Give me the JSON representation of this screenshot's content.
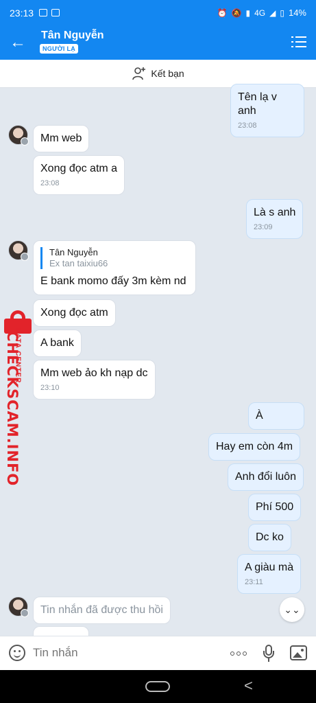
{
  "status_bar": {
    "time": "23:13",
    "battery": "14%",
    "network": "4G"
  },
  "header": {
    "contact_name": "Tân Nguyễn",
    "badge": "NGƯỜI LẠ",
    "back_icon": "arrow-left-icon",
    "menu_icon": "list-menu-icon"
  },
  "add_friend": {
    "label": "Kết bạn",
    "icon": "add-person-icon"
  },
  "messages": [
    {
      "from": "me",
      "text": "Tên lạ v anh",
      "time": "23:08"
    },
    {
      "from": "them",
      "text": "Mm web"
    },
    {
      "from": "them",
      "text": "Xong đọc atm a",
      "time": "23:08"
    },
    {
      "from": "me",
      "text": "Là s anh",
      "time": "23:09"
    },
    {
      "from": "them",
      "quote_name": "Tân Nguyễn",
      "quote_text": "Ex tan taixiu66",
      "text": "E bank momo đấy 3m kèm nd"
    },
    {
      "from": "them",
      "text": "Xong đọc atm"
    },
    {
      "from": "them",
      "text": "A bank"
    },
    {
      "from": "them",
      "text": "Mm web ảo kh nạp dc",
      "time": "23:10"
    },
    {
      "from": "me",
      "text": "À"
    },
    {
      "from": "me",
      "text": "Hay em còn 4m"
    },
    {
      "from": "me",
      "text": "Anh đổi luôn"
    },
    {
      "from": "me",
      "text": "Phí 500"
    },
    {
      "from": "me",
      "text": "Dc ko"
    },
    {
      "from": "me",
      "text": "A giàu mà",
      "time": "23:11"
    },
    {
      "from": "them",
      "text": "Tin nhắn đã được thu hồi",
      "recalled": true
    }
  ],
  "watermark": {
    "main": "CHECKSCAM.INFO",
    "sub": "DATA CENTER"
  },
  "input": {
    "placeholder": "Tin nhắn"
  },
  "colors": {
    "accent": "#1387f1",
    "sent_bubble": "#e5f1ff",
    "watermark": "#e2232a"
  }
}
